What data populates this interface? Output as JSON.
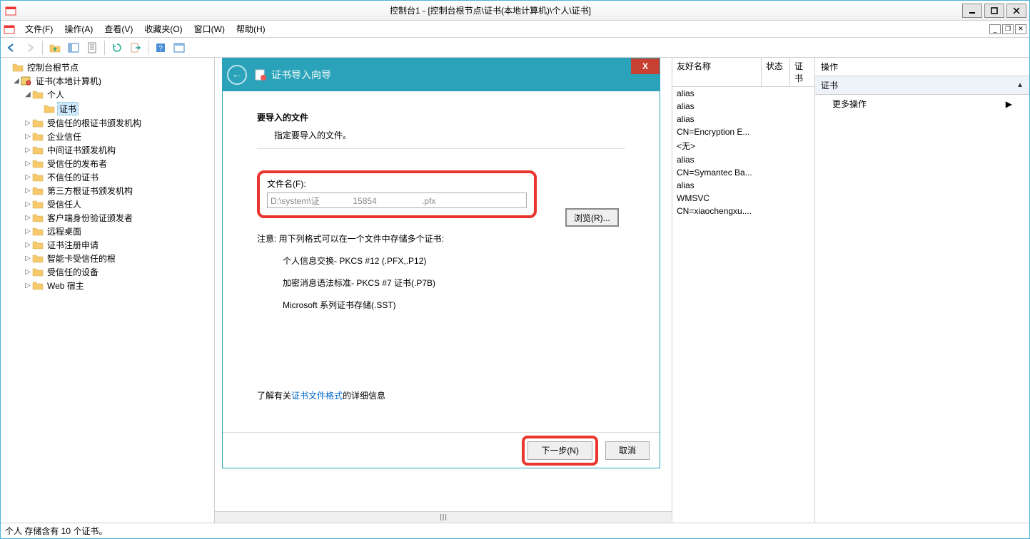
{
  "window": {
    "title": "控制台1 - [控制台根节点\\证书(本地计算机)\\个人\\证书]"
  },
  "menu": {
    "file": "文件(F)",
    "action": "操作(A)",
    "view": "查看(V)",
    "favorites": "收藏夹(O)",
    "window_m": "窗口(W)",
    "help": "帮助(H)"
  },
  "tree": {
    "root": "控制台根节点",
    "certs_local": "证书(本地计算机)",
    "personal": "个人",
    "certificates": "证书",
    "trusted_root": "受信任的根证书颁发机构",
    "enterprise_trust": "企业信任",
    "intermediate": "中间证书颁发机构",
    "trusted_publishers": "受信任的发布者",
    "untrusted": "不信任的证书",
    "third_party_root": "第三方根证书颁发机构",
    "trusted_people": "受信任人",
    "client_auth_issuers": "客户端身份验证颁发者",
    "remote_desktop": "远程桌面",
    "cert_enrollment": "证书注册申请",
    "smartcard_trusted": "智能卡受信任的根",
    "trusted_devices": "受信任的设备",
    "web_hosting": "Web 宿主"
  },
  "list": {
    "col_friendly": "友好名称",
    "col_status": "状态",
    "col_cert": "证书",
    "rows": [
      "alias",
      "alias",
      "alias",
      "CN=Encryption E...",
      "<无>",
      "alias",
      "CN=Symantec Ba...",
      "alias",
      "WMSVC",
      "CN=xiaochengxu...."
    ]
  },
  "actions": {
    "header": "操作",
    "section": "证书",
    "more": "更多操作"
  },
  "status": "个人 存储含有 10 个证书。",
  "wizard": {
    "title": "证书导入向导",
    "heading": "要导入的文件",
    "sub": "指定要导入的文件。",
    "filename_label": "文件名(F):",
    "filename_value": "D:\\system\\证              15854                   .pfx",
    "browse": "浏览(R)...",
    "note": "注意: 用下列格式可以在一个文件中存储多个证书:",
    "fmt1": "个人信息交换- PKCS #12 (.PFX,.P12)",
    "fmt2": "加密消息语法标准- PKCS #7 证书(.P7B)",
    "fmt3": "Microsoft 系列证书存储(.SST)",
    "learn_pre": "了解有关",
    "learn_link": "证书文件格式",
    "learn_post": "的详细信息",
    "next": "下一步(N)",
    "cancel": "取消"
  }
}
